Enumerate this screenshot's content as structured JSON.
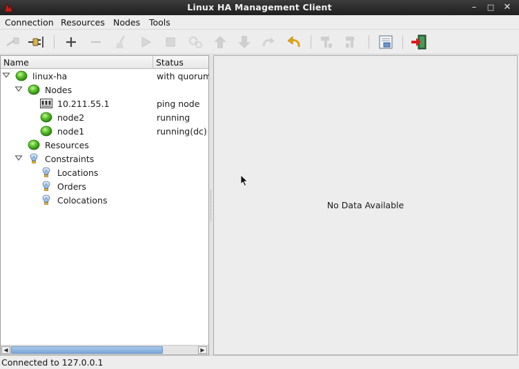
{
  "window": {
    "title": "Linux HA Management Client",
    "controls": [
      "minimize",
      "maximize",
      "close"
    ]
  },
  "menu": [
    "Connection",
    "Resources",
    "Nodes",
    "Tools"
  ],
  "toolbar": {
    "buttons": [
      {
        "icon": "disconnect-icon",
        "enabled": false
      },
      {
        "icon": "connect-icon",
        "enabled": true
      },
      {
        "icon": "add-icon",
        "enabled": true
      },
      {
        "icon": "remove-icon",
        "enabled": false
      },
      {
        "icon": "cleanup-broom-icon",
        "enabled": false
      },
      {
        "icon": "start-icon",
        "enabled": false
      },
      {
        "icon": "stop-icon",
        "enabled": false
      },
      {
        "icon": "gears-icon",
        "enabled": false
      },
      {
        "icon": "move-up-icon",
        "enabled": false
      },
      {
        "icon": "move-down-icon",
        "enabled": false
      },
      {
        "icon": "redo-icon",
        "enabled": false
      },
      {
        "icon": "undo-icon",
        "enabled": true
      },
      {
        "icon": "standby-icon",
        "enabled": false
      },
      {
        "icon": "active-icon",
        "enabled": false
      },
      {
        "icon": "view-log-icon",
        "enabled": true
      },
      {
        "icon": "exit-icon",
        "enabled": true
      }
    ]
  },
  "tree": {
    "columns": {
      "name": "Name",
      "status": "Status"
    },
    "rows": [
      {
        "label": "linux-ha",
        "status": "with quorum",
        "icon": "green-status-icon",
        "expanded": true
      },
      {
        "label": "Nodes",
        "status": "",
        "icon": "green-status-icon",
        "expanded": true
      },
      {
        "label": "10.211.55.1",
        "status": "ping node",
        "icon": "ping-node-icon"
      },
      {
        "label": "node2",
        "status": "running",
        "icon": "green-status-icon"
      },
      {
        "label": "node1",
        "status": "running(dc)",
        "icon": "green-status-icon"
      },
      {
        "label": "Resources",
        "status": "",
        "icon": "green-status-icon"
      },
      {
        "label": "Constraints",
        "status": "",
        "icon": "constraint-icon",
        "expanded": true
      },
      {
        "label": "Locations",
        "status": "",
        "icon": "constraint-icon"
      },
      {
        "label": "Orders",
        "status": "",
        "icon": "constraint-icon"
      },
      {
        "label": "Colocations",
        "status": "",
        "icon": "constraint-icon"
      }
    ]
  },
  "detail": {
    "empty_text": "No Data Available"
  },
  "status_bar": {
    "text": "Connected to 127.0.0.1"
  },
  "colors": {
    "status_green": "#3fae1f",
    "scroll_thumb": "#7aa6d8",
    "title_bg": "#2a2a2a"
  }
}
